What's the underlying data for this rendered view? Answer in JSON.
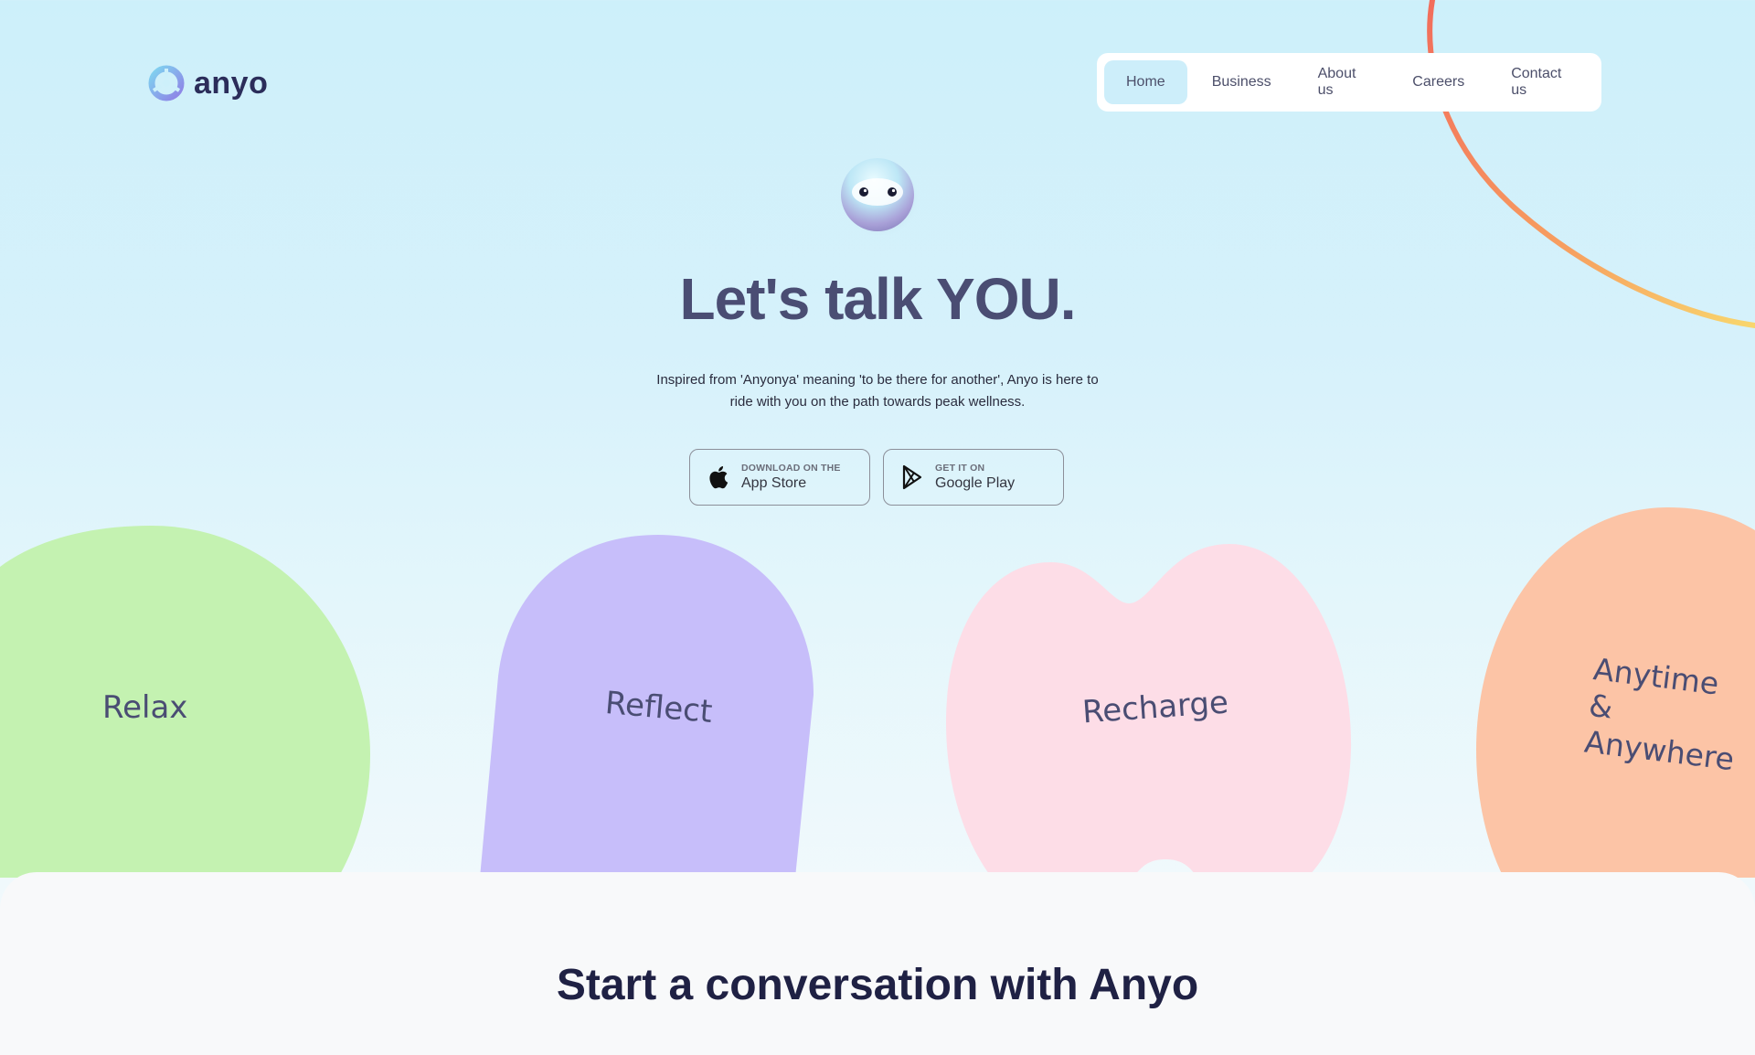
{
  "brand": {
    "name": "anyo"
  },
  "nav": {
    "items": [
      {
        "label": "Home",
        "active": true
      },
      {
        "label": "Business",
        "active": false
      },
      {
        "label": "About us",
        "active": false
      },
      {
        "label": "Careers",
        "active": false
      },
      {
        "label": "Contact us",
        "active": false
      }
    ]
  },
  "hero": {
    "headline": "Let's talk YOU.",
    "subtext": "Inspired from 'Anyonya' meaning 'to be there for another', Anyo is here to ride with you on the path towards peak wellness.",
    "app_store": {
      "small": "DOWNLOAD ON THE",
      "big": "App Store",
      "icon": "apple-icon"
    },
    "google_play": {
      "small": "GET IT ON",
      "big": "Google Play",
      "icon": "google-play-icon"
    }
  },
  "blobs": [
    {
      "label": "Relax",
      "color": "#c4f2b1"
    },
    {
      "label": "Reflect",
      "color": "#c7befa"
    },
    {
      "label": "Recharge",
      "color": "#fddde7"
    },
    {
      "label": "Anytime & Anywhere",
      "color": "#fcc4a6"
    }
  ],
  "section": {
    "title": "Start a conversation with Anyo"
  },
  "colors": {
    "accent_active": "#cdeefa",
    "headline": "#4a4d73",
    "arc_start": "#f26d5b",
    "arc_end": "#f8d66d"
  }
}
